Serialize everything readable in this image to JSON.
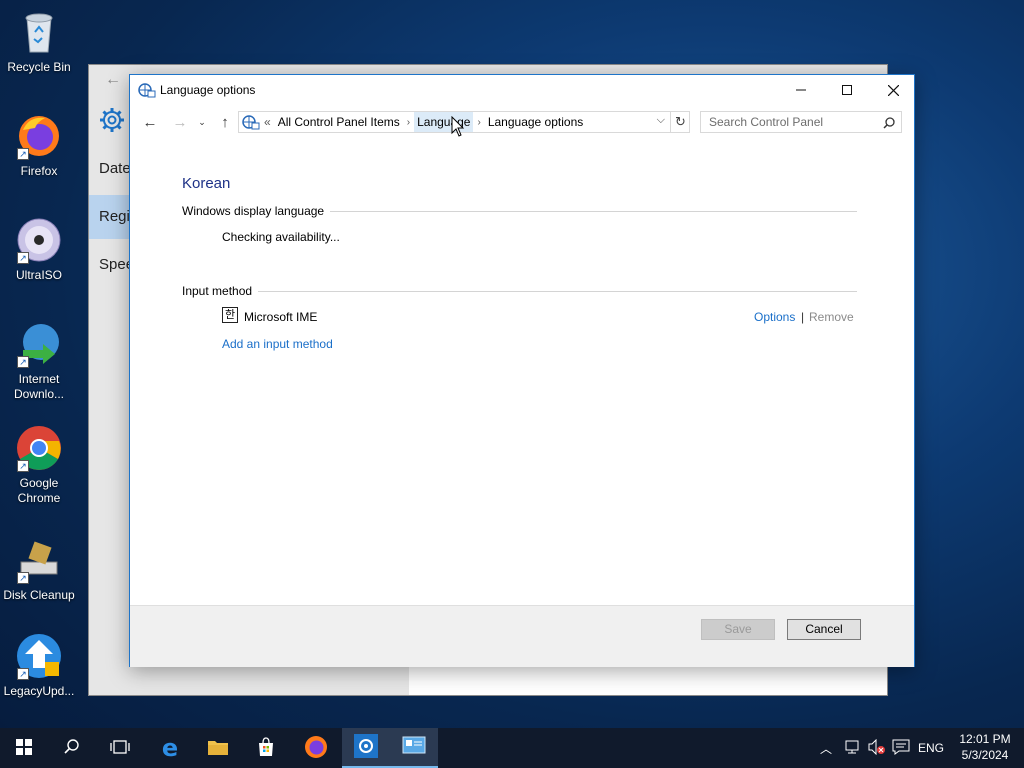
{
  "desktop": {
    "icons": [
      {
        "label": "Recycle Bin"
      },
      {
        "label": "Firefox"
      },
      {
        "label": "UltraISO"
      },
      {
        "label": "Internet Downlo..."
      },
      {
        "label": "Google Chrome"
      },
      {
        "label": "Disk Cleanup"
      },
      {
        "label": "LegacyUpd..."
      }
    ]
  },
  "background_window": {
    "items": [
      {
        "label": "Date"
      },
      {
        "label": "Regi"
      },
      {
        "label": "Spee"
      }
    ]
  },
  "dialog": {
    "title": "Language options",
    "address": {
      "overflow": "«",
      "crumbs": [
        "All Control Panel Items",
        "Language",
        "Language options"
      ]
    },
    "search_placeholder": "Search Control Panel",
    "language_name": "Korean",
    "display_language": {
      "label": "Windows display language",
      "status": "Checking availability..."
    },
    "input_method": {
      "label": "Input method",
      "ime_icon_char": "한",
      "ime_name": "Microsoft IME",
      "options_link": "Options",
      "separator": "|",
      "remove_link": "Remove",
      "add_link": "Add an input method"
    },
    "buttons": {
      "save": "Save",
      "cancel": "Cancel"
    }
  },
  "taskbar": {
    "language": "ENG",
    "time": "12:01 PM",
    "date": "5/3/2024"
  },
  "colors": {
    "accent": "#1e74c8",
    "link": "#1a6fc9",
    "heading": "#1e3287"
  }
}
